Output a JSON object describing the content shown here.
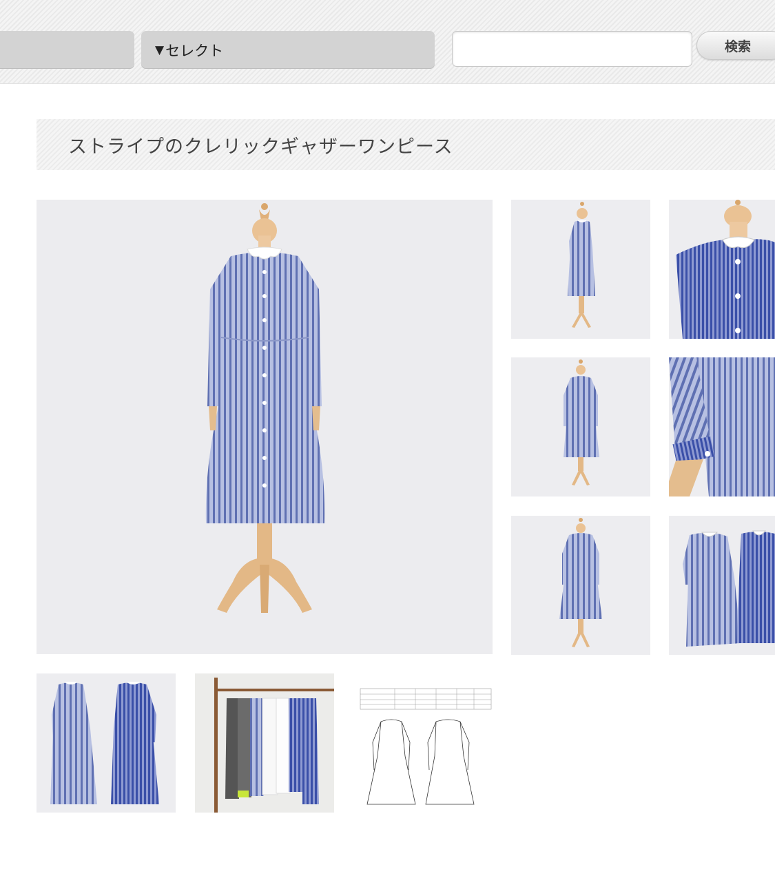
{
  "search": {
    "select_arrow": "▼",
    "select_label": "セレクト",
    "input_value": "",
    "input_placeholder": "",
    "button_label": "検索"
  },
  "product": {
    "title": "ストライプのクレリックギャザーワンピース"
  },
  "gallery": {
    "images": [
      {
        "name": "main-product-image",
        "icon": "dress-front-view"
      },
      {
        "name": "thumbnail-side-view",
        "icon": "dress-side-view"
      },
      {
        "name": "thumbnail-collar-detail",
        "icon": "collar-detail"
      },
      {
        "name": "thumbnail-back-view",
        "icon": "dress-back-view"
      },
      {
        "name": "thumbnail-cuff-detail",
        "icon": "cuff-detail"
      },
      {
        "name": "thumbnail-back-full",
        "icon": "dress-back-full"
      },
      {
        "name": "thumbnail-two-dresses",
        "icon": "two-dresses"
      },
      {
        "name": "thumbnail-two-dresses-back",
        "icon": "two-dresses-back"
      },
      {
        "name": "thumbnail-hanging-rack",
        "icon": "clothes-rack"
      },
      {
        "name": "thumbnail-size-chart",
        "icon": "size-chart-diagram"
      }
    ]
  },
  "colors": {
    "stripe_blue": "#5d6fb0",
    "stripe_light": "#b3bde0",
    "dress_base": "#9aa6d4",
    "wood": "#e3b886",
    "background": "#ededf0"
  }
}
